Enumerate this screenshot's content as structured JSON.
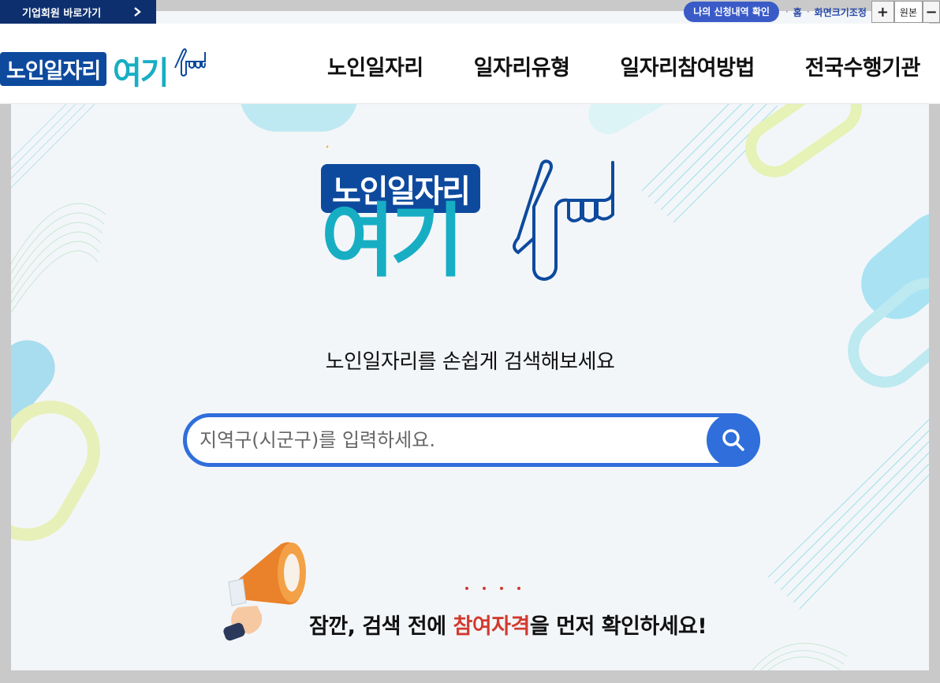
{
  "topbar": {
    "corporate_link": "기업회원 바로가기",
    "my_application": "나의 신청내역 확인",
    "separator": "·",
    "home": "홈",
    "screen_size": "화면크기조정",
    "zoom_in": "+",
    "zoom_reset": "원본",
    "zoom_out": "−"
  },
  "header": {
    "logo_box": "노인일자리",
    "logo_word": "여기",
    "nav": [
      "노인일자리",
      "일자리유형",
      "일자리참여방법",
      "전국수행기관"
    ]
  },
  "hero": {
    "logo_box": "노인일자리",
    "logo_word": "여기",
    "headline": "노인일자리를 손쉽게 검색해보세요",
    "search_placeholder": "지역구(시군구)를 입력하세요.",
    "notice_before": "잠깐, 검색 전에 ",
    "notice_accent": "참여자격",
    "notice_after": "을 먼저 확인하세요!"
  },
  "colors": {
    "navy": "#0d2f6e",
    "logo_blue": "#0d4a9e",
    "logo_teal": "#17aec4",
    "search_blue": "#2f6edb",
    "accent_red": "#d23a2f"
  }
}
